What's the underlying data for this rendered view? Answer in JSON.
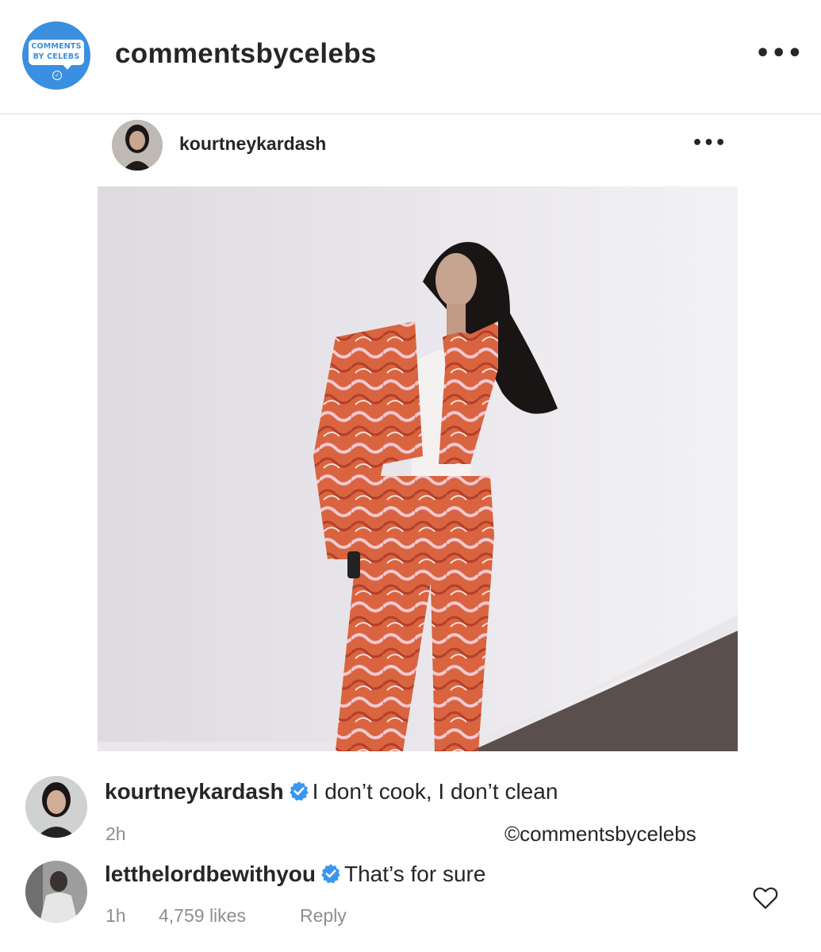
{
  "header": {
    "logo_text_line1": "COMMENTS",
    "logo_text_line2": "BY CELEBS",
    "account_name": "commentsbycelebs",
    "more_icon": "more-horizontal-icon"
  },
  "post": {
    "username": "kourtneykardash",
    "more_icon": "more-horizontal-icon",
    "photo_description_icon": "photo"
  },
  "comments": [
    {
      "username": "kourtneykardash",
      "verified": true,
      "text": "I don’t cook, I don’t clean",
      "time": "2h",
      "watermark": "©commentsbycelebs"
    },
    {
      "username": "letthelordbewithyou",
      "verified": true,
      "text": "That’s for sure",
      "time": "1h",
      "likes": "4,759 likes",
      "reply_label": "Reply"
    }
  ],
  "colors": {
    "logo_blue": "#3b8fe0",
    "verified_blue": "#3897f0",
    "text": "#262626",
    "muted": "#8e8e8e",
    "outfit_orange": "#d9643f"
  }
}
